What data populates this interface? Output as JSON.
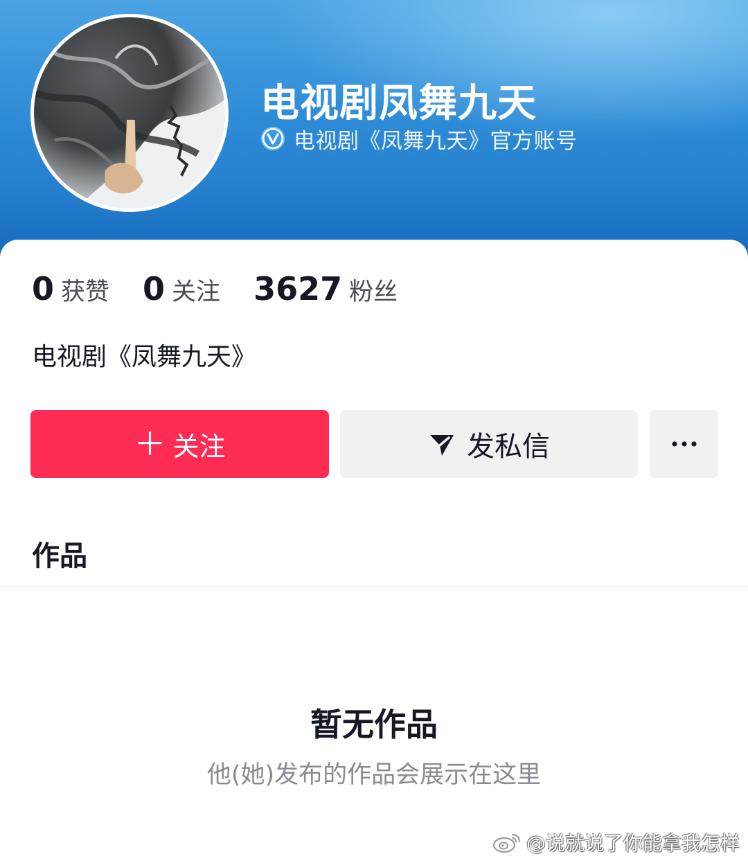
{
  "header": {
    "name": "电视剧凤舞九天",
    "verified_text": "电视剧《凤舞九天》官方账号",
    "verify_icon": "verified-v-badge"
  },
  "stats": [
    {
      "value": "0",
      "label": "获赞"
    },
    {
      "value": "0",
      "label": "关注"
    },
    {
      "value": "3627",
      "label": "粉丝"
    }
  ],
  "bio": "电视剧《凤舞九天》",
  "actions": {
    "follow_label": "关注",
    "follow_icon": "plus-icon",
    "message_label": "发私信",
    "message_icon": "send-icon",
    "more_icon": "ellipsis-icon"
  },
  "tabs": {
    "works": "作品"
  },
  "empty_state": {
    "title": "暂无作品",
    "subtitle": "他(她)发布的作品会展示在这里"
  },
  "watermark": {
    "text": "@说就说了你能拿我怎样",
    "icon": "weibo-icon"
  },
  "colors": {
    "accent": "#fe2c55",
    "banner": "#2d8ad6",
    "secondary_button": "#f1f1f2"
  }
}
